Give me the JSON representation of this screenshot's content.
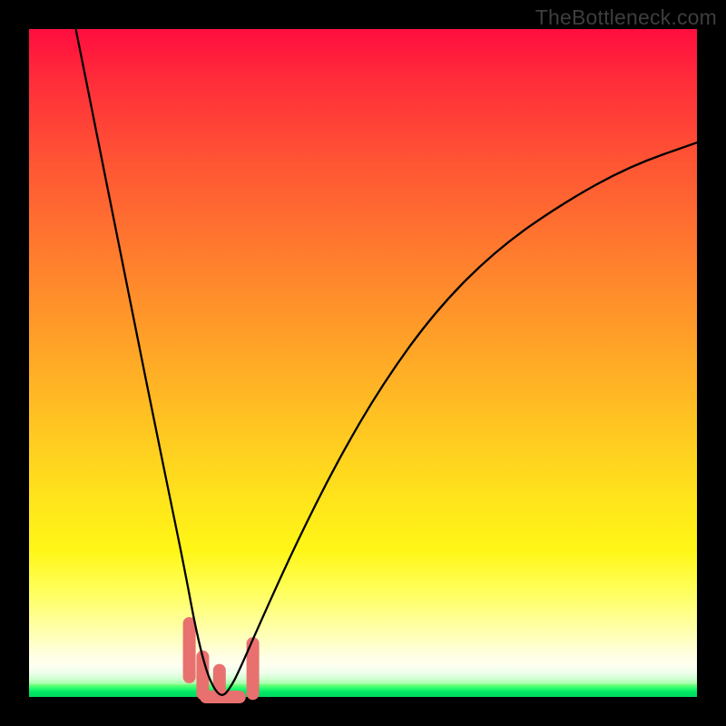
{
  "watermark": "TheBottleneck.com",
  "colors": {
    "accent_stub": "#e8716f",
    "curve": "#000000",
    "frame": "#000000",
    "green_bottom": "#00d85f"
  },
  "chart_data": {
    "type": "line",
    "title": "",
    "xlabel": "",
    "ylabel": "",
    "xlim": [
      0,
      100
    ],
    "ylim": [
      0,
      100
    ],
    "note": "Bottleneck-style V-curve: color gradient encodes mismatch severity (red=high, green=optimal). Single black curve with a sharp minimum; short pink stubs mark recommended range near the minimum.",
    "series": [
      {
        "name": "bottleneck_curve",
        "x": [
          7,
          10,
          13,
          16,
          19,
          21.5,
          23.5,
          25,
          26.5,
          27.8,
          29,
          30.2,
          31.5,
          35,
          40,
          46,
          53,
          61,
          70,
          80,
          90,
          100
        ],
        "y": [
          100,
          85,
          70,
          55,
          40,
          28,
          18,
          10,
          4,
          1,
          0,
          1.5,
          4,
          12,
          23,
          35,
          47,
          58,
          67,
          74,
          79.5,
          83
        ]
      }
    ],
    "highlight_stubs": [
      {
        "x": 24.0,
        "y0": 11.0,
        "y1": 3.0
      },
      {
        "x": 26.0,
        "y0": 6.0,
        "y1": 0.5
      },
      {
        "x": 28.5,
        "y0": 4.0,
        "y1": 0.0
      },
      {
        "x": 31.0,
        "y0": 0.0,
        "y1": 0.0
      },
      {
        "x": 33.5,
        "y0": 8.0,
        "y1": 0.5
      }
    ]
  }
}
